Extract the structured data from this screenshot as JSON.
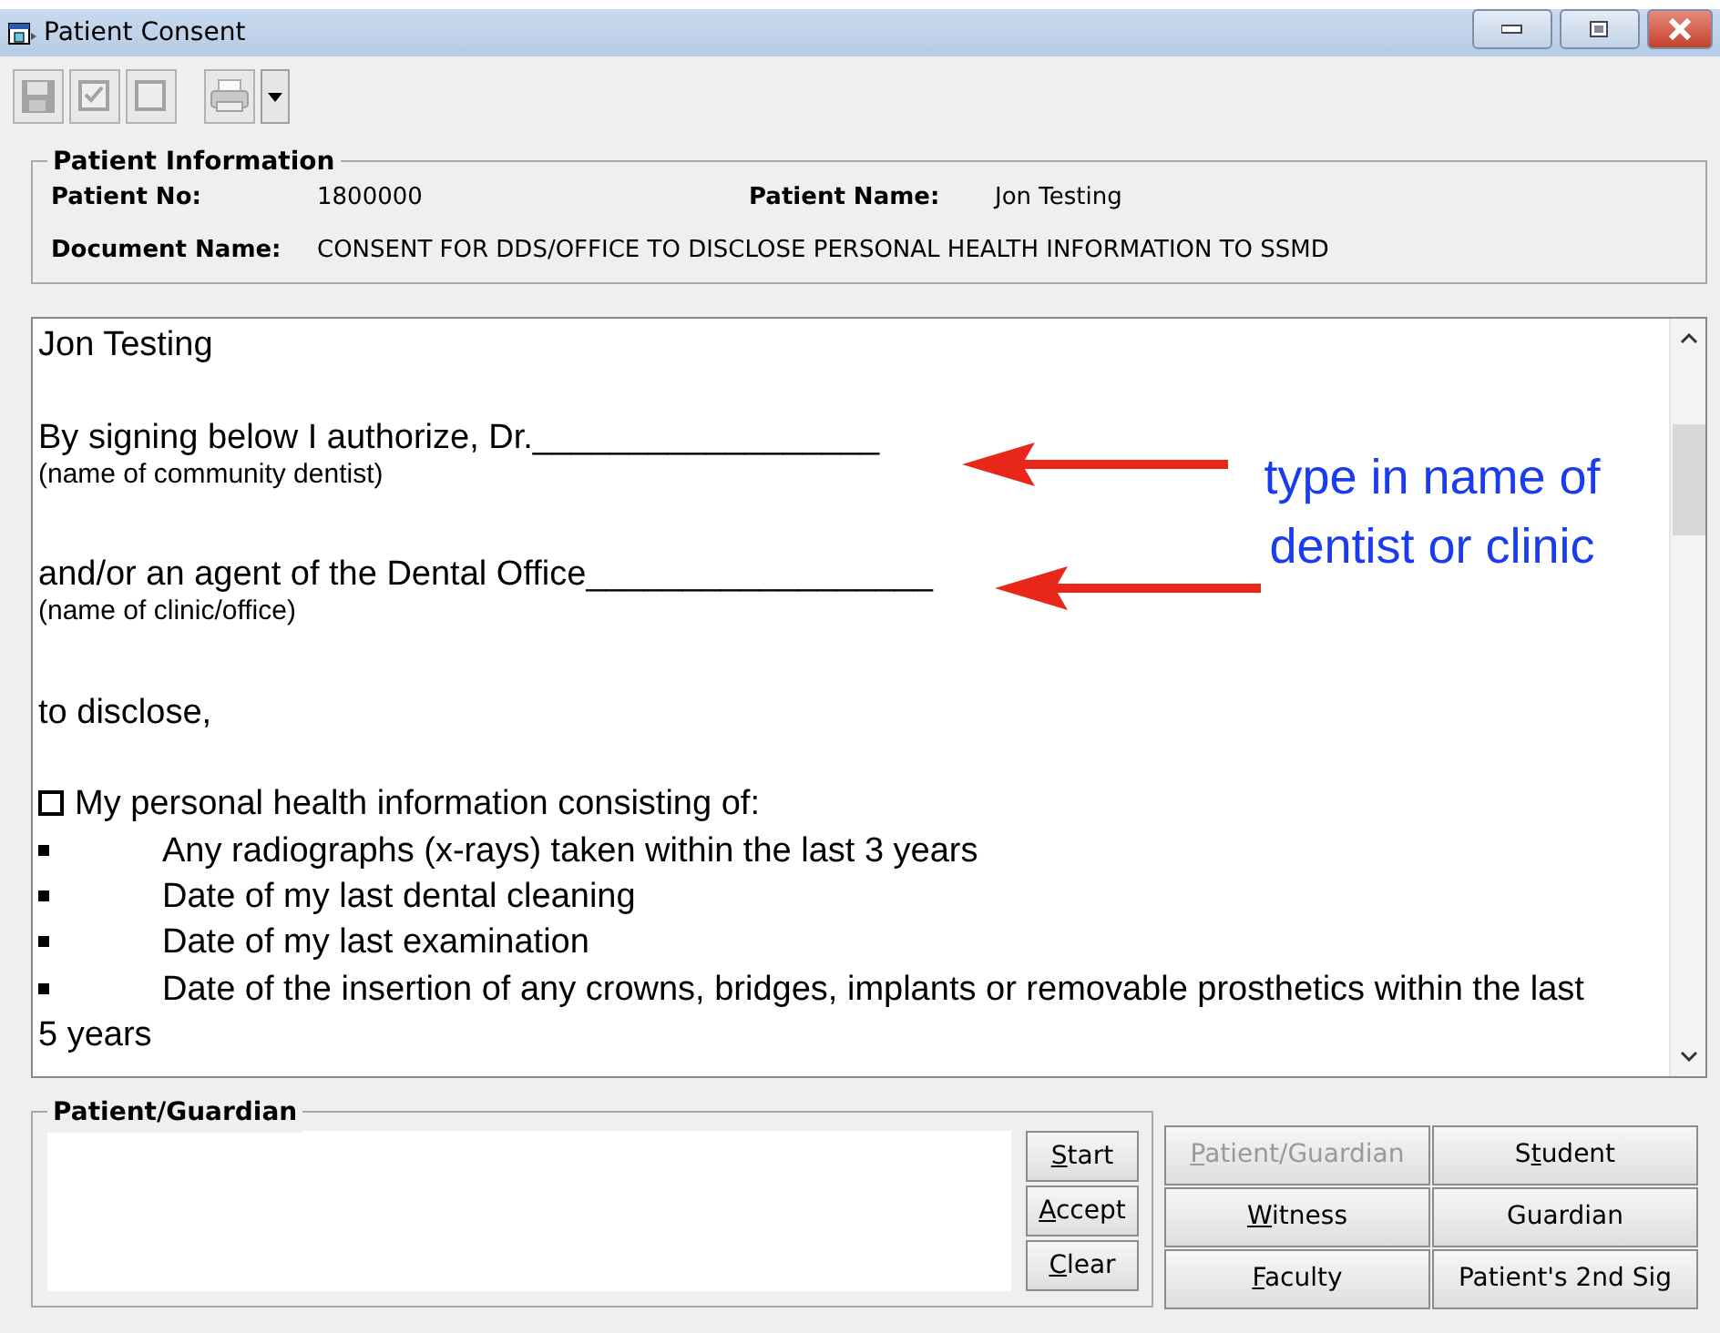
{
  "window": {
    "title": "Patient Consent"
  },
  "toolbar": [
    {
      "kind": "save"
    },
    {
      "kind": "check-all"
    },
    {
      "kind": "uncheck-all"
    },
    {
      "kind": "print"
    }
  ],
  "patient_information": {
    "title": "Patient Information",
    "patient_no_label": "Patient No:",
    "patient_no": "1800000",
    "patient_name_label": "Patient Name:",
    "patient_name": "Jon Testing",
    "document_name_label": "Document Name:",
    "document_name": "CONSENT FOR DDS/OFFICE TO DISCLOSE PERSONAL HEALTH INFORMATION TO SSMD"
  },
  "document": {
    "lines": [
      {
        "kind": "text",
        "text": "Jon Testing"
      },
      {
        "kind": "blank"
      },
      {
        "kind": "text",
        "text": "By signing below I authorize, Dr.__________________"
      },
      {
        "kind": "note",
        "text": "(name of community dentist)"
      },
      {
        "kind": "blank"
      },
      {
        "kind": "text",
        "text": "and/or an agent of the Dental Office__________________"
      },
      {
        "kind": "note",
        "text": "(name of clinic/office)"
      },
      {
        "kind": "blank"
      },
      {
        "kind": "text",
        "text": "to disclose,"
      },
      {
        "kind": "blank"
      },
      {
        "kind": "checkbox",
        "checked": false,
        "text": "My personal health information consisting of:"
      },
      {
        "kind": "bullet",
        "text": "Any radiographs (x-rays) taken within the last 3 years"
      },
      {
        "kind": "bullet",
        "text": "Date of my last dental cleaning"
      },
      {
        "kind": "bullet",
        "text": "Date of my last examination"
      },
      {
        "kind": "bullet",
        "text": "Date of the insertion of any crowns, bridges, implants or removable prosthetics within the last"
      },
      {
        "kind": "text",
        "text": "5 years"
      }
    ],
    "annotations": [
      {
        "text": "type in name of dentist or clinic"
      }
    ]
  },
  "signature": {
    "title": "Patient/Guardian",
    "actions": [
      {
        "key": "S",
        "after": "tart"
      },
      {
        "key": "A",
        "after": "ccept"
      },
      {
        "key": "C",
        "after": "lear"
      }
    ]
  },
  "signers": [
    {
      "key": "P",
      "after": "atient/Guardian",
      "disabled": true
    },
    {
      "before": "S",
      "key": "t",
      "after": "udent",
      "disabled": false
    },
    {
      "key": "W",
      "after": "itness",
      "disabled": false
    },
    {
      "before": "Guardian",
      "disabled": false
    },
    {
      "key": "F",
      "after": "aculty",
      "disabled": false
    },
    {
      "before": "Patient's 2nd Sig",
      "disabled": false
    }
  ]
}
